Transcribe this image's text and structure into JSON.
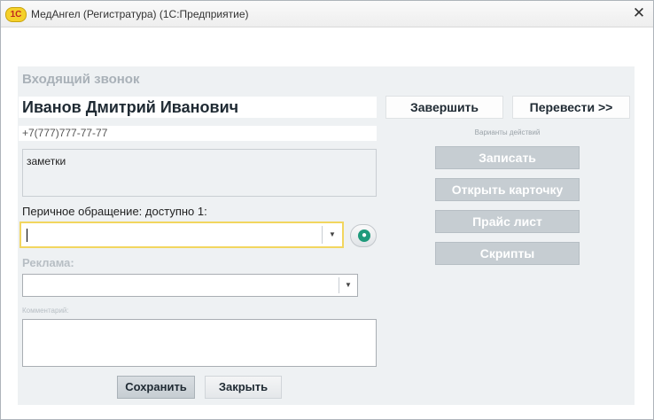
{
  "window": {
    "app_logo": "1С",
    "title": "МедАнгел (Регистратура)  (1С:Предприятие)",
    "close_icon": "close-icon"
  },
  "form": {
    "heading": "Входящий звонок",
    "caller_name": "Иванов Дмитрий Иванович",
    "caller_phone": "+7(777)777-77-77",
    "notes": "заметки",
    "primary_label": "Перичное обращение: доступно 1:",
    "primary_value": "",
    "ad_label": "Реклама:",
    "ad_value": "",
    "comment_label": "Комментарий:",
    "comment_value": ""
  },
  "call_buttons": {
    "finish": "Завершить",
    "transfer": "Перевести >>"
  },
  "actions": {
    "caption": "Варианты действий",
    "items": [
      "Записать",
      "Открыть карточку",
      "Прайс лист",
      "Скрипты"
    ]
  },
  "footer": {
    "save": "Сохранить",
    "close": "Закрыть"
  },
  "colors": {
    "focus_border": "#f2d65f",
    "panel_bg": "#eef1f3",
    "disabled_button": "#c6cdd2",
    "round_button_icon": "#1e9a7b"
  }
}
